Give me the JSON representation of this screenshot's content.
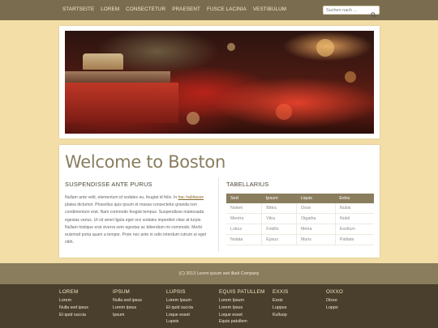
{
  "nav": {
    "items": [
      "STARTSEITE",
      "LOREM",
      "CONSECTETUR",
      "PRAESENT",
      "FUSCE LACINIA",
      "VESTIBULUM"
    ],
    "search_placeholder": "Suchen nach ...",
    "search_icon": "search-icon"
  },
  "hero": {
    "image": "boston-taxi-night-photo"
  },
  "main": {
    "title": "Welcome to Boston",
    "left": {
      "heading": "SUSPENDISSE ANTE PURUS",
      "text_before": "Nullam ante velit, elementum id sodales eu, feugiat id felis. In ",
      "text_highlight": "hac habitasse",
      "text_after": " platea dictumst. Phasellus quis ipsum et massa consectetur gravida non condimentum erat. Nam commodo feugiat tempus. Suspendisse malesuada egestas varius. Ut sit amet ligula eget orci sodales imperdiet vitae at turpis. Nullam tristique erat viverra sem egestas ac bibendum mi commodo. Morbi euismod porta quam a tempor. Proin nec ante in odio interdum rutrum ut eget nibh."
    },
    "right": {
      "heading": "TABELLARIUS",
      "columns": [
        "Sed",
        "Ipsum",
        "Liquis",
        "Extra"
      ],
      "rows": [
        [
          "Nolem",
          "Bittra",
          "Oxxe",
          "Nubis"
        ],
        [
          "Mentra",
          "Vitra",
          "Oigatha",
          "Nobil"
        ],
        [
          "Lukus",
          "Fokillo",
          "Metra",
          "Exellum"
        ],
        [
          "Nolata",
          "Epsus",
          "Muris",
          "Palliata"
        ]
      ]
    }
  },
  "copyright": "(C) 2013 Lorem ipsum sed illuid Company",
  "footer": {
    "columns": [
      {
        "heading": "LOREM",
        "items": [
          "Lorem",
          "Nulla sed ipsus",
          "Et quid succia"
        ]
      },
      {
        "heading": "IPSUM",
        "items": [
          "Nulla sed ipsus",
          "Lorem Ipsus",
          "Ipsum"
        ]
      },
      {
        "heading": "LUPSIS",
        "items": [
          "Lorem Ipsum",
          "Et quid succia",
          "Loque esset",
          "Lupsis"
        ]
      },
      {
        "heading": "EQUIS PATULLEM",
        "items": [
          "Lorem Ipsum",
          "Lorem Ipsus",
          "Loque esset",
          "Equis patullem"
        ]
      },
      {
        "heading": "EXXIS",
        "items": [
          "Exxis",
          "Luppus",
          "Kulluop"
        ]
      },
      {
        "heading": "OIXXO",
        "items": [
          "Oixxo",
          "Loppo"
        ]
      }
    ]
  },
  "colors": {
    "background": "#f2dea6",
    "nav_bar": "#7a6d4f",
    "accent": "#8a7d5e",
    "footer": "#4a3f2c"
  }
}
